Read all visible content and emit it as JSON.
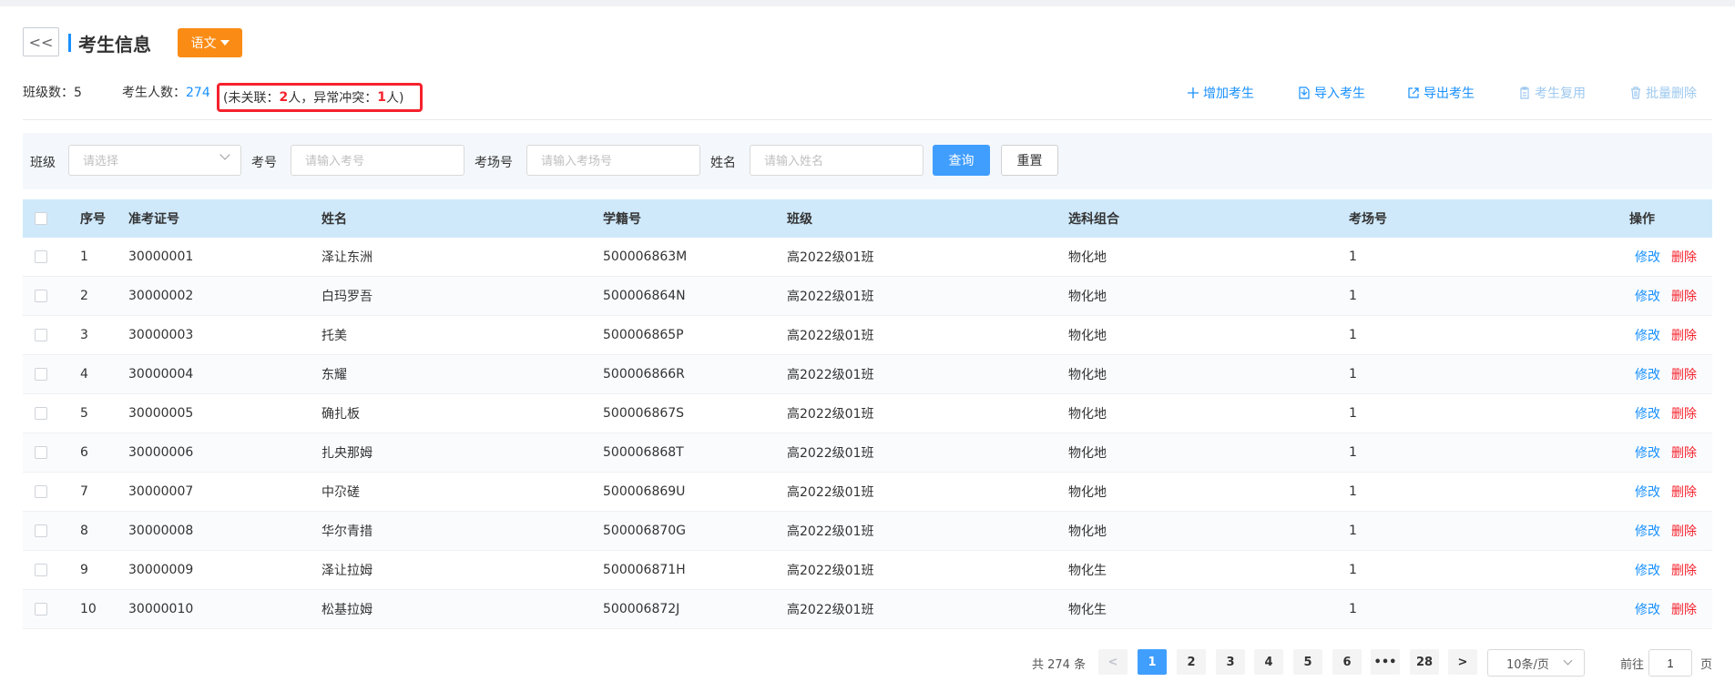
{
  "header": {
    "back_label": "<<",
    "title": "考生信息",
    "subject": "语文"
  },
  "summary": {
    "class_count_label": "班级数：",
    "class_count": "5",
    "student_count_label": "考生人数：",
    "student_count": "274",
    "warn_open": "(未关联：",
    "unlinked": "2",
    "warn_mid": "人，异常冲突：",
    "conflict": "1",
    "warn_close": "人)"
  },
  "toolbar": {
    "add": "增加考生",
    "import": "导入考生",
    "export": "导出考生",
    "reuse": "考生复用",
    "batch_delete": "批量删除"
  },
  "filter": {
    "class_label": "班级",
    "class_placeholder": "请选择",
    "exam_no_label": "考号",
    "exam_no_placeholder": "请输入考号",
    "room_label": "考场号",
    "room_placeholder": "请输入考场号",
    "name_label": "姓名",
    "name_placeholder": "请输入姓名",
    "query": "查询",
    "reset": "重置"
  },
  "table": {
    "columns": [
      "序号",
      "准考证号",
      "姓名",
      "学籍号",
      "班级",
      "选科组合",
      "考场号",
      "操作"
    ],
    "edit_label": "修改",
    "delete_label": "删除",
    "rows": [
      {
        "idx": "1",
        "ticket": "30000001",
        "name": "泽让东洲",
        "sid": "500006863M",
        "cls": "高2022级01班",
        "combo": "物化地",
        "room": "1"
      },
      {
        "idx": "2",
        "ticket": "30000002",
        "name": "白玛罗吾",
        "sid": "500006864N",
        "cls": "高2022级01班",
        "combo": "物化地",
        "room": "1"
      },
      {
        "idx": "3",
        "ticket": "30000003",
        "name": "托美",
        "sid": "500006865P",
        "cls": "高2022级01班",
        "combo": "物化地",
        "room": "1"
      },
      {
        "idx": "4",
        "ticket": "30000004",
        "name": "东耀",
        "sid": "500006866R",
        "cls": "高2022级01班",
        "combo": "物化地",
        "room": "1"
      },
      {
        "idx": "5",
        "ticket": "30000005",
        "name": "确扎板",
        "sid": "500006867S",
        "cls": "高2022级01班",
        "combo": "物化地",
        "room": "1"
      },
      {
        "idx": "6",
        "ticket": "30000006",
        "name": "扎央那姆",
        "sid": "500006868T",
        "cls": "高2022级01班",
        "combo": "物化地",
        "room": "1"
      },
      {
        "idx": "7",
        "ticket": "30000007",
        "name": "中尕磋",
        "sid": "500006869U",
        "cls": "高2022级01班",
        "combo": "物化地",
        "room": "1"
      },
      {
        "idx": "8",
        "ticket": "30000008",
        "name": "华尔青措",
        "sid": "500006870G",
        "cls": "高2022级01班",
        "combo": "物化地",
        "room": "1"
      },
      {
        "idx": "9",
        "ticket": "30000009",
        "name": "泽让拉姆",
        "sid": "500006871H",
        "cls": "高2022级01班",
        "combo": "物化生",
        "room": "1"
      },
      {
        "idx": "10",
        "ticket": "30000010",
        "name": "松基拉姆",
        "sid": "500006872J",
        "cls": "高2022级01班",
        "combo": "物化生",
        "room": "1"
      }
    ]
  },
  "pagination": {
    "total": "共 274 条",
    "prev": "<",
    "next": ">",
    "pages": [
      "1",
      "2",
      "3",
      "4",
      "5",
      "6",
      "•••",
      "28"
    ],
    "active_page": "1",
    "page_size": "10条/页",
    "goto_label": "前往",
    "goto_value": "1",
    "page_unit": "页"
  }
}
